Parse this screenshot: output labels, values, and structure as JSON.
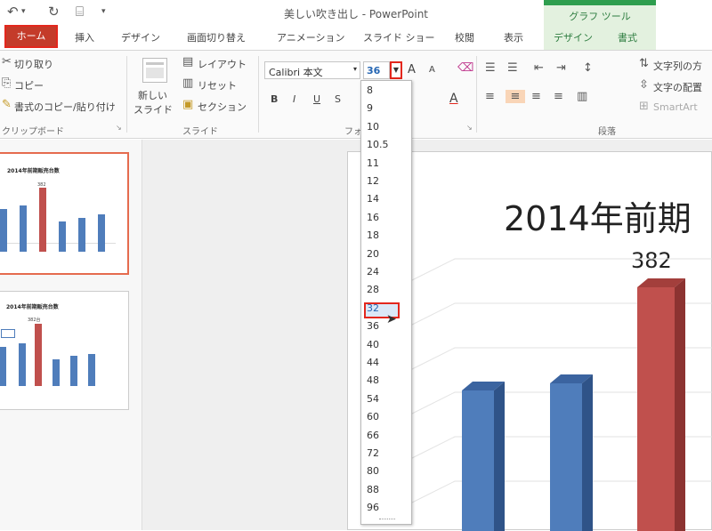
{
  "window": {
    "title": "美しい吹き出し - PowerPoint",
    "quick_access": {
      "undo_icon": "↶",
      "undo_arrow": "▾",
      "redo_icon": "↻",
      "present_icon": "⌸",
      "customize": "▾"
    }
  },
  "context_tab_group": "グラフ ツール",
  "tabs": [
    "ホーム",
    "挿入",
    "デザイン",
    "画面切り替え",
    "アニメーション",
    "スライド ショー",
    "校閲",
    "表示",
    "デザイン",
    "書式"
  ],
  "ribbon": {
    "clipboard": {
      "cut": "切り取り",
      "copy": "コピー",
      "format_painter": "書式のコピー/貼り付け",
      "group": "クリップボード"
    },
    "slides": {
      "new_slide_line1": "新しい",
      "new_slide_line2": "スライド",
      "layout": "レイアウト",
      "reset": "リセット",
      "section": "セクション",
      "group": "スライド"
    },
    "font": {
      "font_name": "Calibri 本文",
      "font_size": "36",
      "grow": "A",
      "shrink": "A",
      "bold": "B",
      "italic": "I",
      "underline": "U",
      "shadow": "S",
      "color": "A",
      "group": "フォ"
    },
    "paragraph": {
      "text_direction": "文字列の方",
      "align_text": "文字の配置",
      "smartart": "SmartArt",
      "group": "段落"
    }
  },
  "thumbnails": [
    {
      "title": "2014年前期販売台数",
      "label": "382"
    },
    {
      "title": "2014年前期販売台数",
      "label": "382台"
    }
  ],
  "slide": {
    "title": "2014年前期",
    "data_label": "382"
  },
  "font_size_options": [
    "8",
    "9",
    "10",
    "10.5",
    "11",
    "12",
    "14",
    "16",
    "18",
    "20",
    "24",
    "28",
    "32",
    "36",
    "40",
    "44",
    "48",
    "54",
    "60",
    "66",
    "72",
    "80",
    "88",
    "96"
  ],
  "selected_option": "32",
  "colors": {
    "accent_red": "#e3271d",
    "bar_blue": "#4f7dbb",
    "bar_red": "#c0504d",
    "context_green": "#2e9e4e"
  }
}
